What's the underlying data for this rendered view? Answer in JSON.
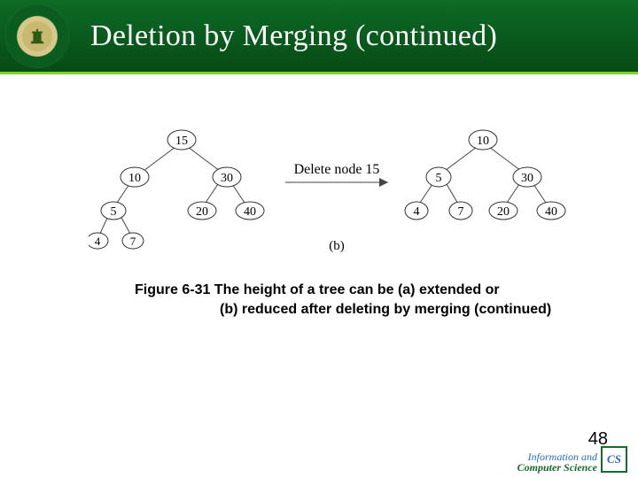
{
  "header": {
    "title": "Deletion by Merging (continued)"
  },
  "diagram": {
    "action": "Delete node 15",
    "figLabel": "(b)",
    "left": {
      "root": "15",
      "l1l": "10",
      "l1r": "30",
      "l2a": "5",
      "l2c": "20",
      "l2d": "40",
      "l3a": "4",
      "l3b": "7"
    },
    "right": {
      "root": "10",
      "l1l": "5",
      "l1r": "30",
      "l2a": "4",
      "l2b": "7",
      "l2c": "20",
      "l2d": "40"
    }
  },
  "caption": {
    "line1": "Figure 6-31 The height of a tree can be (a) extended or",
    "line2": "(b) reduced after deleting by merging (continued)"
  },
  "footer": {
    "slideNumber": "48",
    "logoTop": "Information and",
    "logoBottom": "Computer Science",
    "logoAbbr": "CS"
  }
}
